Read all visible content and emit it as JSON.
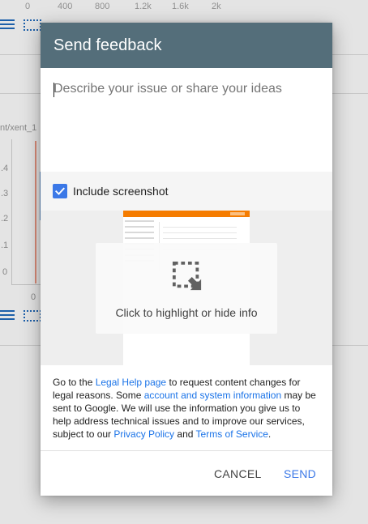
{
  "background": {
    "axis_ticks": [
      "0",
      "400",
      "800",
      "1.2k",
      "1.6k",
      "2k"
    ],
    "series_label": "nt/xent_1",
    "y_ticks": [
      ".4",
      ".3",
      ".2",
      ".1",
      "0"
    ],
    "bottom_tick": "0"
  },
  "dialog": {
    "title": "Send feedback",
    "description_placeholder": "Describe your issue or share your ideas",
    "include_screenshot": {
      "label": "Include screenshot",
      "checked": true
    },
    "screenshot_hint": "Click to highlight or hide info",
    "legal": {
      "p1": "Go to the ",
      "link_legal_help": "Legal Help page",
      "p2": " to request content changes for legal reasons. Some ",
      "link_account_info": "account and system information",
      "p3": " may be sent to Google. We will use the information you give us to help address technical issues and to improve our services, subject to our ",
      "link_privacy": "Privacy Policy",
      "p4": " and ",
      "link_terms": "Terms of Service",
      "p5": "."
    },
    "buttons": {
      "cancel": "CANCEL",
      "send": "SEND"
    }
  },
  "colors": {
    "header": "#546e7a",
    "accent": "#3b78e7",
    "link": "#1a73e8"
  }
}
